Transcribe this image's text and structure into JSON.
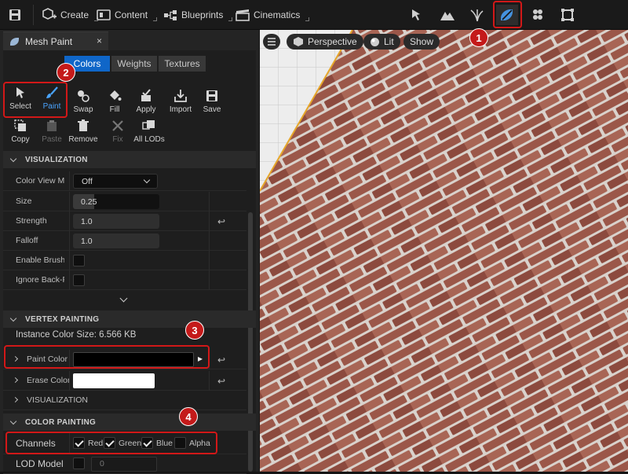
{
  "toolbar": {
    "create_label": "Create",
    "content_label": "Content",
    "blueprints_label": "Blueprints",
    "cinematics_label": "Cinematics"
  },
  "panel": {
    "title": "Mesh Paint",
    "close_label": "×",
    "tabs": [
      "Colors",
      "Weights",
      "Textures"
    ],
    "tools_row1": [
      "Select",
      "Paint",
      "Swap",
      "Fill",
      "Apply",
      "Import",
      "Save"
    ],
    "tools_row2": [
      "Copy",
      "Paste",
      "Remove",
      "Fix",
      "All LODs"
    ]
  },
  "visualization": {
    "header": "VISUALIZATION",
    "color_view_label": "Color View Mo",
    "color_view_value": "Off",
    "size_label": "Size",
    "size_value": "0.25",
    "strength_label": "Strength",
    "strength_value": "1.0",
    "falloff_label": "Falloff",
    "falloff_value": "1.0",
    "enable_brush_label": "Enable Brush F",
    "ignore_back_label": "Ignore Back-F"
  },
  "vertex_painting": {
    "header": "VERTEX PAINTING",
    "instance_size": "Instance Color Size: 6.566 KB",
    "paint_color_label": "Paint Color",
    "erase_color_label": "Erase Color",
    "visualization_label": "VISUALIZATION",
    "paint_color": "#000000",
    "erase_color": "#ffffff"
  },
  "color_painting": {
    "header": "COLOR PAINTING",
    "channels_label": "Channels",
    "channels": [
      {
        "name": "Red",
        "checked": true
      },
      {
        "name": "Green",
        "checked": true
      },
      {
        "name": "Blue",
        "checked": true
      },
      {
        "name": "Alpha",
        "checked": false
      }
    ],
    "lod_label": "LOD Model F",
    "lod_value": "0"
  },
  "viewport": {
    "perspective_label": "Perspective",
    "lit_label": "Lit",
    "show_label": "Show"
  },
  "callouts": [
    "1",
    "2",
    "3",
    "4"
  ],
  "colors": {
    "accent": "#0f66c8",
    "callout": "#d21818",
    "brick": "#8a4b3f",
    "mortar": "#d9d2cc"
  }
}
